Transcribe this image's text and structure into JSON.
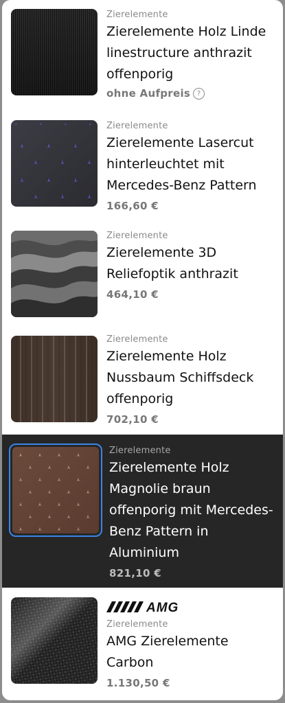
{
  "items": [
    {
      "category": "Zierelemente",
      "title": "Zierelemente Holz Linde linestructure anthrazit offenporig",
      "price": "ohne Aufpreis",
      "help_icon": "?"
    },
    {
      "category": "Zierelemente",
      "title": "Zierelemente Lasercut hinterleuchtet mit Mercedes-Benz Pattern",
      "price": "166,60 €"
    },
    {
      "category": "Zierelemente",
      "title": "Zierelemente 3D Reliefoptik anthrazit",
      "price": "464,10 €"
    },
    {
      "category": "Zierelemente",
      "title": "Zierelemente Holz Nussbaum Schiffsdeck offenporig",
      "price": "702,10 €"
    },
    {
      "category": "Zierelemente",
      "title": "Zierelemente Holz Magnolie braun offenporig mit Mercedes-Benz Pattern in Aluminium",
      "price": "821,10 €",
      "selected": true
    },
    {
      "brand": "AMG",
      "category": "Zierelemente",
      "title": "AMG Zierelemente Carbon",
      "price": "1.130,50 €"
    }
  ],
  "colors": {
    "selected_bg": "#262626",
    "selected_border": "#3b86e6",
    "price": "#777777",
    "category": "#8a8a8a"
  },
  "icons": [
    "help-circle-icon",
    "amg-logo"
  ]
}
